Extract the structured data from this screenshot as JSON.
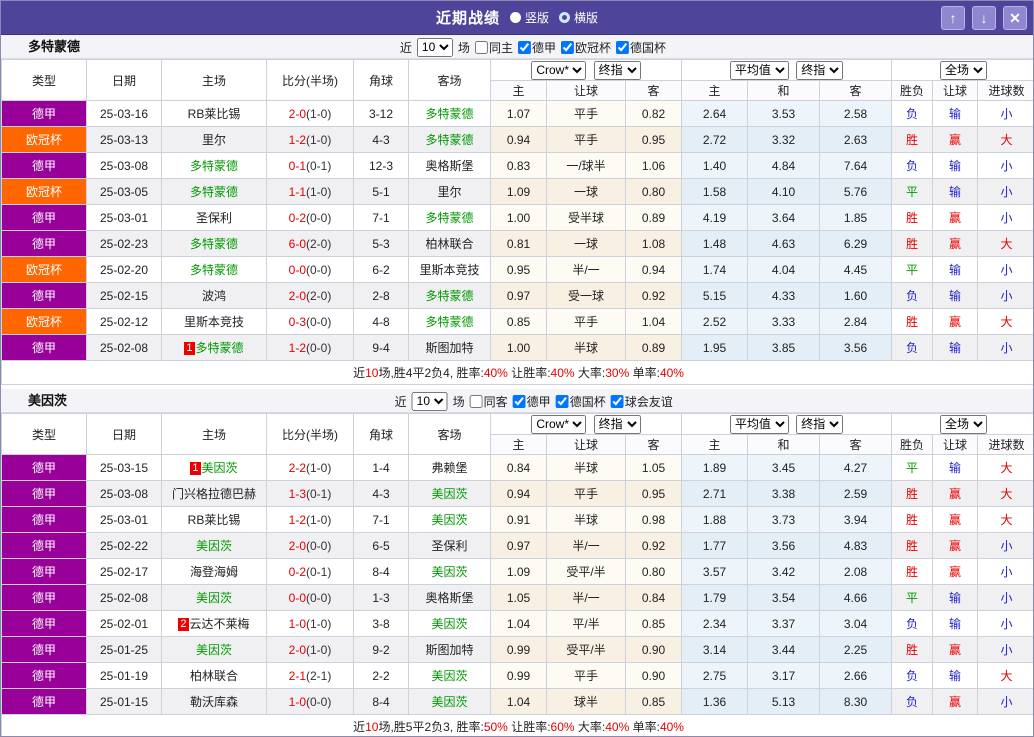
{
  "titlebar": {
    "title": "近期战绩",
    "view_options": [
      {
        "label": "竖版",
        "selected": false
      },
      {
        "label": "横版",
        "selected": true
      }
    ],
    "up_glyph": "↑",
    "down_glyph": "↓",
    "close_glyph": "✕",
    "bar_color": "#4e4499"
  },
  "league_classes": {
    "德甲": "purple",
    "欧冠杯": "orange"
  },
  "league_colors": {
    "德甲": "#990099",
    "欧冠杯": "#ff6600"
  },
  "result_classes": {
    "胜": "c-red",
    "赢": "c-red",
    "大": "c-red",
    "负": "c-blue",
    "输": "c-blue",
    "小": "c-blue",
    "平": "c-green"
  },
  "result_colors": {
    "win_red": "#e60000",
    "lose_blue": "#2222cc",
    "draw_green": "#009900"
  },
  "team_highlight_color": "#009900",
  "table_header": {
    "left_cols": [
      "类型",
      "日期",
      "主场",
      "比分(半场)",
      "角球",
      "客场"
    ],
    "crow_select_1": "Crow*",
    "crow_select_2": "终指",
    "crow_cols": [
      "主",
      "让球",
      "客"
    ],
    "avg_select_1": "平均值",
    "avg_select_2": "终指",
    "avg_cols": [
      "主",
      "和",
      "客"
    ],
    "full_select": "全场",
    "result_cols": [
      "胜负",
      "让球",
      "进球数"
    ]
  },
  "sections": [
    {
      "team": "多特蒙德",
      "filter": {
        "prefix": "近",
        "count": "10",
        "suffix": "场",
        "same": {
          "label": "同主",
          "checked": false
        },
        "league_1": {
          "label": "德甲",
          "checked": true
        },
        "league_2": {
          "label": "欧冠杯",
          "checked": true
        },
        "league_3": {
          "label": "德国杯",
          "checked": true
        }
      },
      "rows": [
        {
          "league": "德甲",
          "date": "25-03-16",
          "home": "RB莱比锡",
          "home_green": false,
          "home_badge": "",
          "score": "2-0",
          "half": "(1-0)",
          "corner": "3-12",
          "away": "多特蒙德",
          "away_green": true,
          "away_badge": "",
          "crow_home": "1.07",
          "handicap": "平手",
          "crow_away": "0.82",
          "avg_home": "2.64",
          "avg_draw": "3.53",
          "avg_away": "2.58",
          "res_wdl": "负",
          "res_handicap": "输",
          "res_goals": "小"
        },
        {
          "league": "欧冠杯",
          "date": "25-03-13",
          "home": "里尔",
          "home_green": false,
          "home_badge": "",
          "score": "1-2",
          "half": "(1-0)",
          "corner": "4-3",
          "away": "多特蒙德",
          "away_green": true,
          "away_badge": "",
          "crow_home": "0.94",
          "handicap": "平手",
          "crow_away": "0.95",
          "avg_home": "2.72",
          "avg_draw": "3.32",
          "avg_away": "2.63",
          "res_wdl": "胜",
          "res_handicap": "赢",
          "res_goals": "大"
        },
        {
          "league": "德甲",
          "date": "25-03-08",
          "home": "多特蒙德",
          "home_green": true,
          "home_badge": "",
          "score": "0-1",
          "half": "(0-1)",
          "corner": "12-3",
          "away": "奥格斯堡",
          "away_green": false,
          "away_badge": "",
          "crow_home": "0.83",
          "handicap": "一/球半",
          "crow_away": "1.06",
          "avg_home": "1.40",
          "avg_draw": "4.84",
          "avg_away": "7.64",
          "res_wdl": "负",
          "res_handicap": "输",
          "res_goals": "小"
        },
        {
          "league": "欧冠杯",
          "date": "25-03-05",
          "home": "多特蒙德",
          "home_green": true,
          "home_badge": "",
          "score": "1-1",
          "half": "(1-0)",
          "corner": "5-1",
          "away": "里尔",
          "away_green": false,
          "away_badge": "",
          "crow_home": "1.09",
          "handicap": "一球",
          "crow_away": "0.80",
          "avg_home": "1.58",
          "avg_draw": "4.10",
          "avg_away": "5.76",
          "res_wdl": "平",
          "res_handicap": "输",
          "res_goals": "小"
        },
        {
          "league": "德甲",
          "date": "25-03-01",
          "home": "圣保利",
          "home_green": false,
          "home_badge": "",
          "score": "0-2",
          "half": "(0-0)",
          "corner": "7-1",
          "away": "多特蒙德",
          "away_green": true,
          "away_badge": "",
          "crow_home": "1.00",
          "handicap": "受半球",
          "crow_away": "0.89",
          "avg_home": "4.19",
          "avg_draw": "3.64",
          "avg_away": "1.85",
          "res_wdl": "胜",
          "res_handicap": "赢",
          "res_goals": "小"
        },
        {
          "league": "德甲",
          "date": "25-02-23",
          "home": "多特蒙德",
          "home_green": true,
          "home_badge": "",
          "score": "6-0",
          "half": "(2-0)",
          "corner": "5-3",
          "away": "柏林联合",
          "away_green": false,
          "away_badge": "",
          "crow_home": "0.81",
          "handicap": "一球",
          "crow_away": "1.08",
          "avg_home": "1.48",
          "avg_draw": "4.63",
          "avg_away": "6.29",
          "res_wdl": "胜",
          "res_handicap": "赢",
          "res_goals": "大"
        },
        {
          "league": "欧冠杯",
          "date": "25-02-20",
          "home": "多特蒙德",
          "home_green": true,
          "home_badge": "",
          "score": "0-0",
          "half": "(0-0)",
          "corner": "6-2",
          "away": "里斯本竞技",
          "away_green": false,
          "away_badge": "",
          "crow_home": "0.95",
          "handicap": "半/一",
          "crow_away": "0.94",
          "avg_home": "1.74",
          "avg_draw": "4.04",
          "avg_away": "4.45",
          "res_wdl": "平",
          "res_handicap": "输",
          "res_goals": "小"
        },
        {
          "league": "德甲",
          "date": "25-02-15",
          "home": "波鸿",
          "home_green": false,
          "home_badge": "",
          "score": "2-0",
          "half": "(2-0)",
          "corner": "2-8",
          "away": "多特蒙德",
          "away_green": true,
          "away_badge": "",
          "crow_home": "0.97",
          "handicap": "受一球",
          "crow_away": "0.92",
          "avg_home": "5.15",
          "avg_draw": "4.33",
          "avg_away": "1.60",
          "res_wdl": "负",
          "res_handicap": "输",
          "res_goals": "小"
        },
        {
          "league": "欧冠杯",
          "date": "25-02-12",
          "home": "里斯本竞技",
          "home_green": false,
          "home_badge": "",
          "score": "0-3",
          "half": "(0-0)",
          "corner": "4-8",
          "away": "多特蒙德",
          "away_green": true,
          "away_badge": "",
          "crow_home": "0.85",
          "handicap": "平手",
          "crow_away": "1.04",
          "avg_home": "2.52",
          "avg_draw": "3.33",
          "avg_away": "2.84",
          "res_wdl": "胜",
          "res_handicap": "赢",
          "res_goals": "大"
        },
        {
          "league": "德甲",
          "date": "25-02-08",
          "home": "多特蒙德",
          "home_green": true,
          "home_badge": "1",
          "score": "1-2",
          "half": "(0-0)",
          "corner": "9-4",
          "away": "斯图加特",
          "away_green": false,
          "away_badge": "",
          "crow_home": "1.00",
          "handicap": "半球",
          "crow_away": "0.89",
          "avg_home": "1.95",
          "avg_draw": "3.85",
          "avg_away": "3.56",
          "res_wdl": "负",
          "res_handicap": "输",
          "res_goals": "小"
        }
      ],
      "summary": [
        {
          "t": "近"
        },
        {
          "t": "10",
          "red": true
        },
        {
          "t": "场,胜4平2负4, 胜率:"
        },
        {
          "t": "40%",
          "red": true
        },
        {
          "t": " 让胜率:"
        },
        {
          "t": "40%",
          "red": true
        },
        {
          "t": " 大率:"
        },
        {
          "t": "30%",
          "red": true
        },
        {
          "t": " 单率:"
        },
        {
          "t": "40%",
          "red": true
        }
      ]
    },
    {
      "team": "美因茨",
      "filter": {
        "prefix": "近",
        "count": "10",
        "suffix": "场",
        "same": {
          "label": "同客",
          "checked": false
        },
        "league_1": {
          "label": "德甲",
          "checked": true
        },
        "league_2": {
          "label": "德国杯",
          "checked": true
        },
        "league_3": {
          "label": "球会友谊",
          "checked": true
        }
      },
      "rows": [
        {
          "league": "德甲",
          "date": "25-03-15",
          "home": "美因茨",
          "home_green": true,
          "home_badge": "1",
          "score": "2-2",
          "half": "(1-0)",
          "corner": "1-4",
          "away": "弗赖堡",
          "away_green": false,
          "away_badge": "",
          "crow_home": "0.84",
          "handicap": "半球",
          "crow_away": "1.05",
          "avg_home": "1.89",
          "avg_draw": "3.45",
          "avg_away": "4.27",
          "res_wdl": "平",
          "res_handicap": "输",
          "res_goals": "大"
        },
        {
          "league": "德甲",
          "date": "25-03-08",
          "home": "门兴格拉德巴赫",
          "home_green": false,
          "home_badge": "",
          "score": "1-3",
          "half": "(0-1)",
          "corner": "4-3",
          "away": "美因茨",
          "away_green": true,
          "away_badge": "",
          "crow_home": "0.94",
          "handicap": "平手",
          "crow_away": "0.95",
          "avg_home": "2.71",
          "avg_draw": "3.38",
          "avg_away": "2.59",
          "res_wdl": "胜",
          "res_handicap": "赢",
          "res_goals": "大"
        },
        {
          "league": "德甲",
          "date": "25-03-01",
          "home": "RB莱比锡",
          "home_green": false,
          "home_badge": "",
          "score": "1-2",
          "half": "(1-0)",
          "corner": "7-1",
          "away": "美因茨",
          "away_green": true,
          "away_badge": "",
          "crow_home": "0.91",
          "handicap": "半球",
          "crow_away": "0.98",
          "avg_home": "1.88",
          "avg_draw": "3.73",
          "avg_away": "3.94",
          "res_wdl": "胜",
          "res_handicap": "赢",
          "res_goals": "大"
        },
        {
          "league": "德甲",
          "date": "25-02-22",
          "home": "美因茨",
          "home_green": true,
          "home_badge": "",
          "score": "2-0",
          "half": "(0-0)",
          "corner": "6-5",
          "away": "圣保利",
          "away_green": false,
          "away_badge": "",
          "crow_home": "0.97",
          "handicap": "半/一",
          "crow_away": "0.92",
          "avg_home": "1.77",
          "avg_draw": "3.56",
          "avg_away": "4.83",
          "res_wdl": "胜",
          "res_handicap": "赢",
          "res_goals": "小"
        },
        {
          "league": "德甲",
          "date": "25-02-17",
          "home": "海登海姆",
          "home_green": false,
          "home_badge": "",
          "score": "0-2",
          "half": "(0-1)",
          "corner": "8-4",
          "away": "美因茨",
          "away_green": true,
          "away_badge": "",
          "crow_home": "1.09",
          "handicap": "受平/半",
          "crow_away": "0.80",
          "avg_home": "3.57",
          "avg_draw": "3.42",
          "avg_away": "2.08",
          "res_wdl": "胜",
          "res_handicap": "赢",
          "res_goals": "小"
        },
        {
          "league": "德甲",
          "date": "25-02-08",
          "home": "美因茨",
          "home_green": true,
          "home_badge": "",
          "score": "0-0",
          "half": "(0-0)",
          "corner": "1-3",
          "away": "奥格斯堡",
          "away_green": false,
          "away_badge": "",
          "crow_home": "1.05",
          "handicap": "半/一",
          "crow_away": "0.84",
          "avg_home": "1.79",
          "avg_draw": "3.54",
          "avg_away": "4.66",
          "res_wdl": "平",
          "res_handicap": "输",
          "res_goals": "小"
        },
        {
          "league": "德甲",
          "date": "25-02-01",
          "home": "云达不莱梅",
          "home_green": false,
          "home_badge": "2",
          "score": "1-0",
          "half": "(1-0)",
          "corner": "3-8",
          "away": "美因茨",
          "away_green": true,
          "away_badge": "",
          "crow_home": "1.04",
          "handicap": "平/半",
          "crow_away": "0.85",
          "avg_home": "2.34",
          "avg_draw": "3.37",
          "avg_away": "3.04",
          "res_wdl": "负",
          "res_handicap": "输",
          "res_goals": "小"
        },
        {
          "league": "德甲",
          "date": "25-01-25",
          "home": "美因茨",
          "home_green": true,
          "home_badge": "",
          "score": "2-0",
          "half": "(1-0)",
          "corner": "9-2",
          "away": "斯图加特",
          "away_green": false,
          "away_badge": "",
          "crow_home": "0.99",
          "handicap": "受平/半",
          "crow_away": "0.90",
          "avg_home": "3.14",
          "avg_draw": "3.44",
          "avg_away": "2.25",
          "res_wdl": "胜",
          "res_handicap": "赢",
          "res_goals": "小"
        },
        {
          "league": "德甲",
          "date": "25-01-19",
          "home": "柏林联合",
          "home_green": false,
          "home_badge": "",
          "score": "2-1",
          "half": "(2-1)",
          "corner": "2-2",
          "away": "美因茨",
          "away_green": true,
          "away_badge": "",
          "crow_home": "0.99",
          "handicap": "平手",
          "crow_away": "0.90",
          "avg_home": "2.75",
          "avg_draw": "3.17",
          "avg_away": "2.66",
          "res_wdl": "负",
          "res_handicap": "输",
          "res_goals": "大"
        },
        {
          "league": "德甲",
          "date": "25-01-15",
          "home": "勒沃库森",
          "home_green": false,
          "home_badge": "",
          "score": "1-0",
          "half": "(0-0)",
          "corner": "8-4",
          "away": "美因茨",
          "away_green": true,
          "away_badge": "",
          "crow_home": "1.04",
          "handicap": "球半",
          "crow_away": "0.85",
          "avg_home": "1.36",
          "avg_draw": "5.13",
          "avg_away": "8.30",
          "res_wdl": "负",
          "res_handicap": "赢",
          "res_goals": "小"
        }
      ],
      "summary": [
        {
          "t": "近"
        },
        {
          "t": "10",
          "red": true
        },
        {
          "t": "场,胜5平2负3, 胜率:"
        },
        {
          "t": "50%",
          "red": true
        },
        {
          "t": " 让胜率:"
        },
        {
          "t": "60%",
          "red": true
        },
        {
          "t": " 大率:"
        },
        {
          "t": "40%",
          "red": true
        },
        {
          "t": " 单率:"
        },
        {
          "t": "40%",
          "red": true
        }
      ]
    }
  ]
}
